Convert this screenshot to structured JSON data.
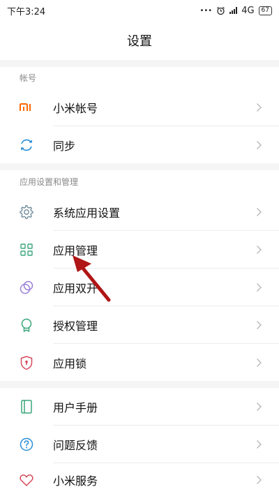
{
  "status_bar": {
    "time": "下午3:24",
    "dots": "•••",
    "network": "4G",
    "battery": "67"
  },
  "header": {
    "title": "设置"
  },
  "sections": [
    {
      "title": "帐号",
      "items": [
        {
          "label": "小米帐号",
          "icon": "mi-logo-icon"
        },
        {
          "label": "同步",
          "icon": "sync-icon"
        }
      ]
    },
    {
      "title": "应用设置和管理",
      "items": [
        {
          "label": "系统应用设置",
          "icon": "gear-icon"
        },
        {
          "label": "应用管理",
          "icon": "grid-icon"
        },
        {
          "label": "应用双开",
          "icon": "dual-app-icon"
        },
        {
          "label": "授权管理",
          "icon": "badge-icon"
        },
        {
          "label": "应用锁",
          "icon": "shield-lock-icon"
        }
      ]
    },
    {
      "title": "",
      "items": [
        {
          "label": "用户手册",
          "icon": "book-icon"
        },
        {
          "label": "问题反馈",
          "icon": "question-icon"
        },
        {
          "label": "小米服务",
          "icon": "heart-icon"
        }
      ]
    }
  ],
  "colors": {
    "mi_orange": "#ff6700",
    "icon_blue": "#2a8fd6",
    "icon_gray": "#6b8a9a",
    "icon_green": "#3aa57a",
    "icon_purple": "#9b7fd8",
    "icon_red": "#d64a5a",
    "arrow_red": "#b01616"
  }
}
